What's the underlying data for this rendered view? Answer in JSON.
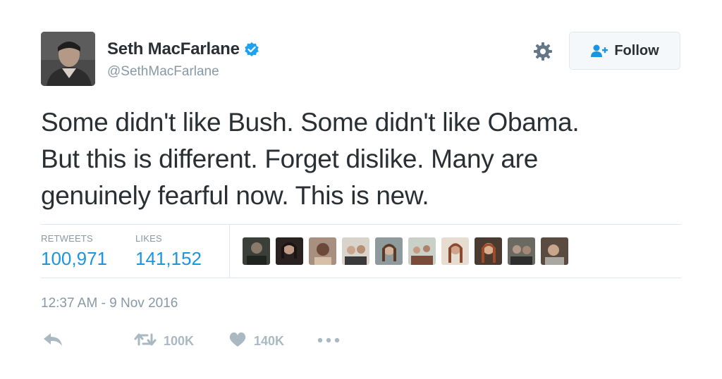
{
  "user": {
    "name": "Seth MacFarlane",
    "handle": "@SethMacFarlane",
    "verified": true
  },
  "follow_button": {
    "label": "Follow"
  },
  "tweet": {
    "lines": [
      "Some didn't like Bush. Some didn't like Obama.",
      "But this is different. Forget dislike. Many are",
      "genuinely fearful now. This is new."
    ]
  },
  "stats": {
    "retweets_label": "RETWEETS",
    "retweets_value": "100,971",
    "likes_label": "LIKES",
    "likes_value": "141,152"
  },
  "timestamp": "12:37 AM - 9 Nov 2016",
  "actions": {
    "retweet_count": "100K",
    "like_count": "140K"
  },
  "colors": {
    "accent": "#1b95e0",
    "muted": "#8899a6",
    "text": "#292f33",
    "verified": "#1da1f2"
  }
}
